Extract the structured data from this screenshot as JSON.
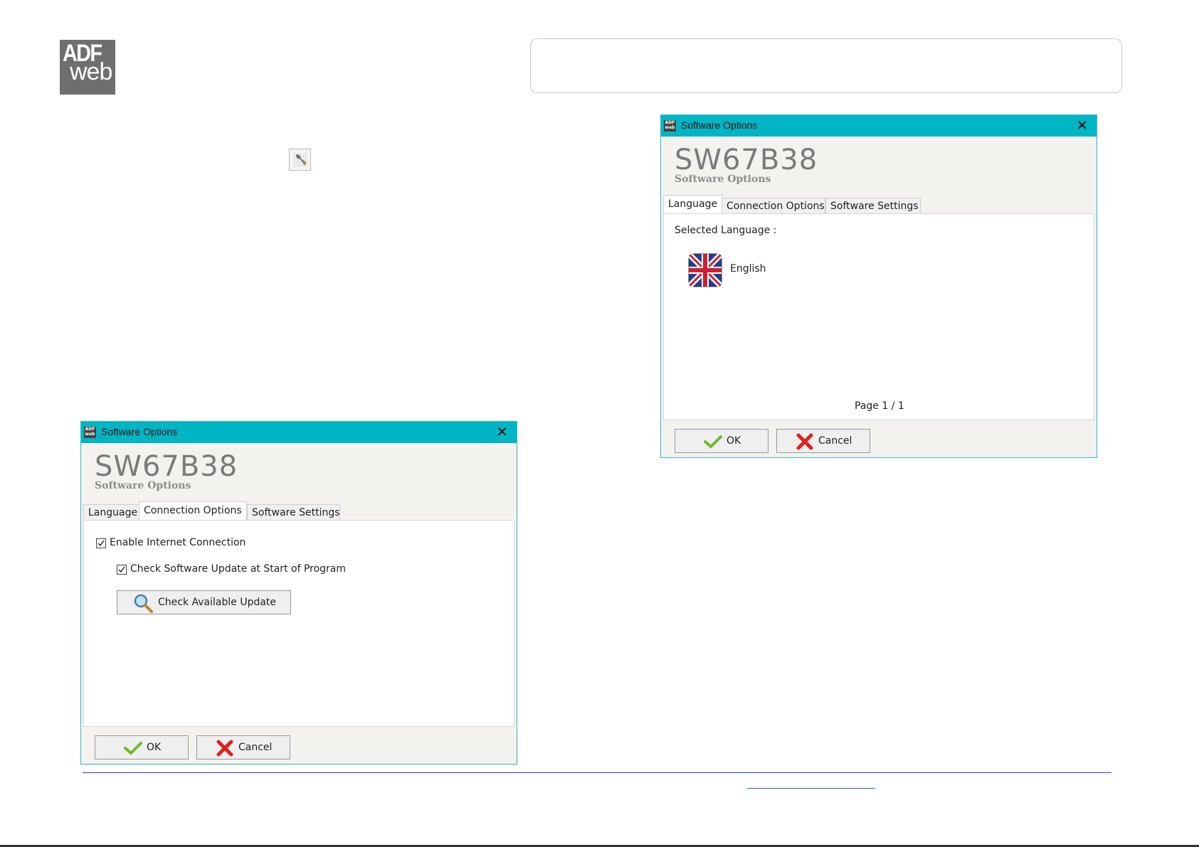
{
  "logo": {
    "line1": "ADF",
    "line2": "web"
  },
  "colors": {
    "titlebar": "#00b5c4",
    "dialog_border": "#2db8c7",
    "footer_line": "#1f4e8c"
  },
  "icons": {
    "wrench": "wrench-icon",
    "ok": "check-icon",
    "cancel": "red-x-icon",
    "search": "magnifier-icon",
    "flag": "uk-flag-icon"
  },
  "dialog_connection": {
    "title": "Software Options",
    "close": "✕",
    "app_icon": "ADF web",
    "model": "SW67B38",
    "subtitle": "Software Options",
    "tabs": [
      "Language",
      "Connection Options",
      "Software Settings"
    ],
    "active_tab": "Connection Options",
    "enable_internet": {
      "label": "Enable Internet Connection",
      "checked": true
    },
    "check_update_start": {
      "label": "Check Software Update at Start of Program",
      "checked": true
    },
    "check_button": "Check Available Update",
    "ok": "OK",
    "cancel": "Cancel"
  },
  "dialog_language": {
    "title": "Software Options",
    "close": "✕",
    "app_icon": "ADF web",
    "model": "SW67B38",
    "subtitle": "Software Options",
    "tabs": [
      "Language",
      "Connection Options",
      "Software Settings"
    ],
    "active_tab": "Language",
    "selected_language_label": "Selected Language :",
    "language": "English",
    "page": "Page 1 / 1",
    "ok": "OK",
    "cancel": "Cancel"
  }
}
